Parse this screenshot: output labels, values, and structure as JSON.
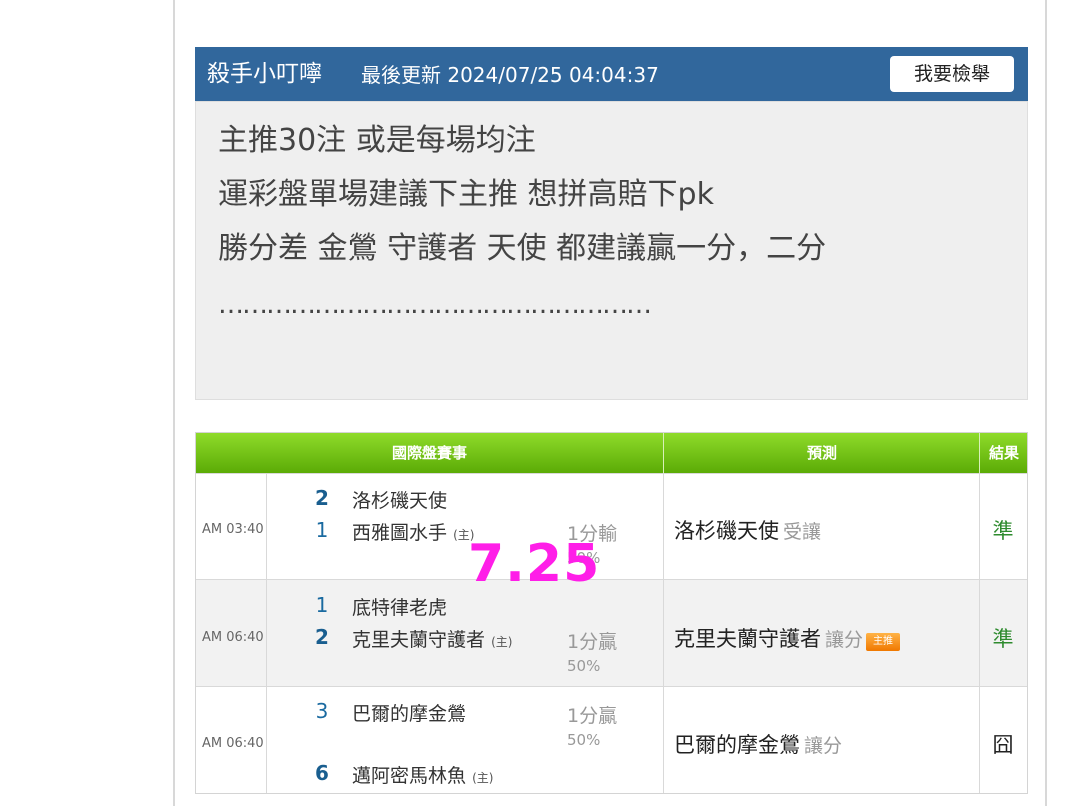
{
  "post": {
    "author": "殺手小叮嚀",
    "updated": "最後更新 2024/07/25 04:04:37",
    "report_button": "我要檢舉",
    "lines": [
      "主推30注 或是每場均注",
      "運彩盤單場建議下主推 想拼高賠下pk",
      "勝分差 金鶯 守護者 天使 都建議贏一分，二分",
      "………………………………………………"
    ]
  },
  "table": {
    "headers": [
      "國際盤賽事",
      "預測",
      "結果"
    ],
    "home_mark": "(主)",
    "rows": [
      {
        "time": "AM 03:40",
        "team_top": "洛杉磯天使",
        "score_top": "2",
        "team_bottom": "西雅圖水手",
        "score_bottom": "1",
        "odds_line": "1分輸",
        "odds_pct": "50%",
        "pick": "洛杉磯天使",
        "pick_type": "受讓",
        "badge": "",
        "result": "準"
      },
      {
        "time": "AM 06:40",
        "team_top": "底特律老虎",
        "score_top": "1",
        "team_bottom": "克里夫蘭守護者",
        "score_bottom": "2",
        "odds_line": "1分贏",
        "odds_pct": "50%",
        "pick": "克里夫蘭守護者",
        "pick_type": "讓分",
        "badge": "主推",
        "result": "準"
      },
      {
        "time": "AM 06:40",
        "team_top": "巴爾的摩金鶯",
        "score_top": "3",
        "team_bottom": "邁阿密馬林魚",
        "score_bottom": "6",
        "odds_line": "1分贏",
        "odds_pct": "50%",
        "pick": "巴爾的摩金鶯",
        "pick_type": "讓分",
        "badge": "",
        "result": "囧"
      }
    ]
  },
  "overlay_text": "7.25",
  "colors": {
    "header_blue": "#31679c",
    "table_green": "#6bbd10",
    "win": "#2e8b2e",
    "overlay": "#ff1ee8"
  }
}
